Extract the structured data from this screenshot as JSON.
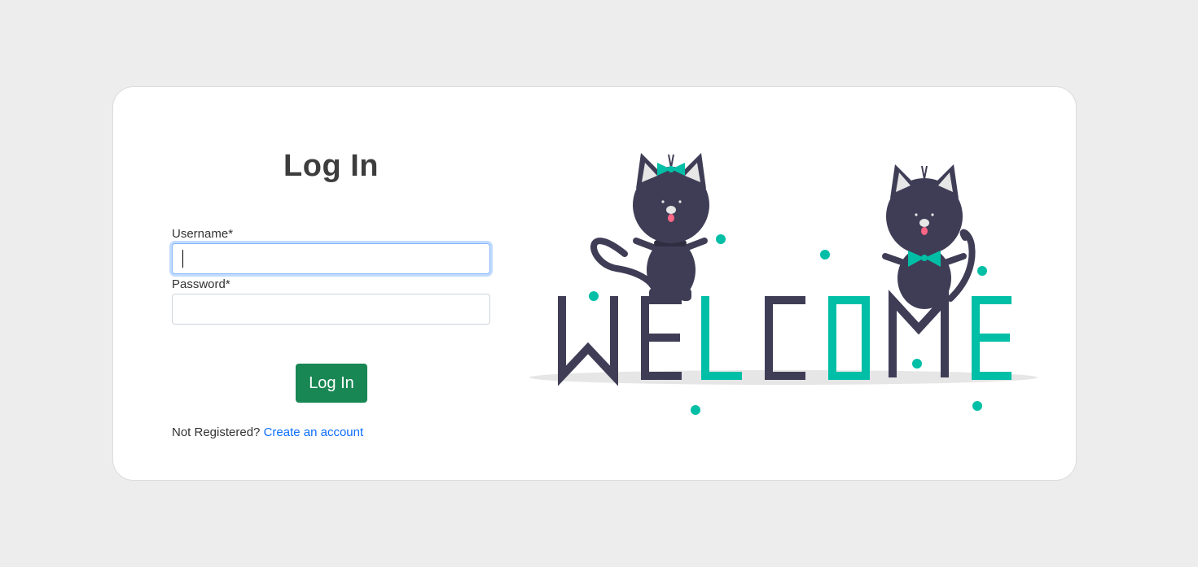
{
  "login": {
    "title": "Log In",
    "username_label": "Username*",
    "username_value": "",
    "password_label": "Password*",
    "password_value": "",
    "submit_label": "Log In",
    "register_prompt": "Not Registered?",
    "register_link": "Create an account"
  },
  "illustration": {
    "word": "WELCOME",
    "icon": "welcome-cats-illustration"
  },
  "colors": {
    "background": "#ededed",
    "card": "#ffffff",
    "primary_button": "#198754",
    "link": "#0d6efd",
    "accent_teal": "#00bfa6",
    "dark_purple": "#3f3d56",
    "focus_ring": "#86b7fe"
  }
}
